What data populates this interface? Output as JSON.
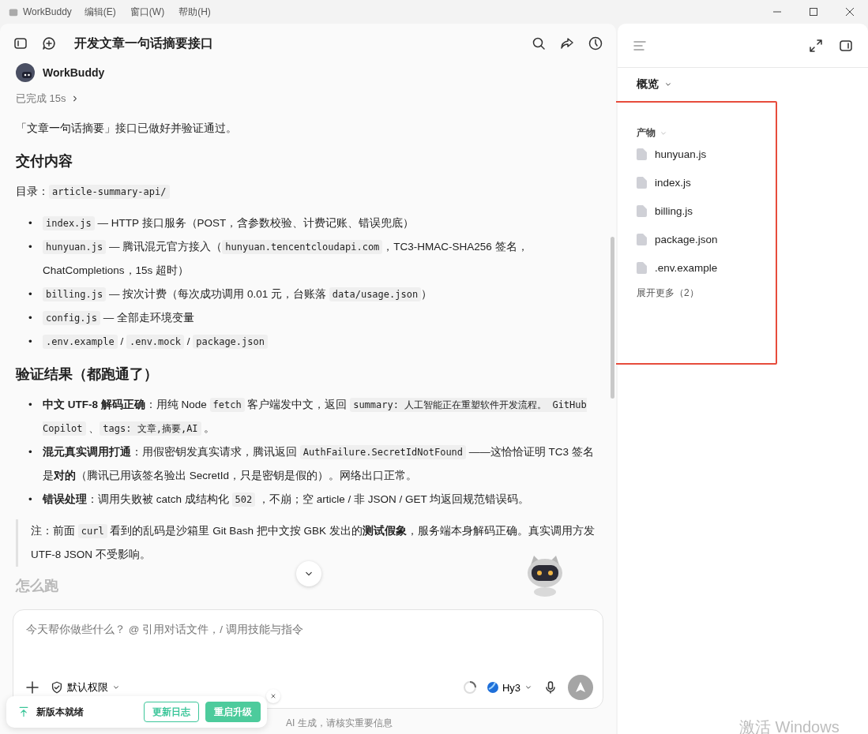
{
  "titlebar": {
    "app_name": "WorkBuddy",
    "menus": [
      "编辑(E)",
      "窗口(W)",
      "帮助(H)"
    ]
  },
  "chat": {
    "title": "开发文章一句话摘要接口",
    "sender": "WorkBuddy",
    "status": "已完成 15s",
    "blocks": [
      {
        "kind": "para",
        "segments": [
          {
            "kind": "text",
            "text": "「文章一句话摘要」接口已做好并验证通过。"
          }
        ]
      },
      {
        "kind": "heading",
        "text": "交付内容"
      },
      {
        "kind": "para",
        "segments": [
          {
            "kind": "text",
            "text": "目录："
          },
          {
            "kind": "code",
            "text": "article-summary-api/"
          }
        ]
      },
      {
        "kind": "list",
        "items": [
          {
            "marker": "•",
            "segments": [
              {
                "kind": "code",
                "text": "index.js"
              },
              {
                "kind": "text",
                "text": " — HTTP 接口服务（POST，含参数校验、计费记账、错误兜底）"
              }
            ]
          },
          {
            "marker": "•",
            "segments": [
              {
                "kind": "code",
                "text": "hunyuan.js"
              },
              {
                "kind": "text",
                "text": " — 腾讯混元官方接入（"
              },
              {
                "kind": "code",
                "text": "hunyuan.tencentcloudapi.com"
              },
              {
                "kind": "text",
                "text": "，TC3-HMAC-SHA256 签名，ChatCompletions，15s 超时）"
              }
            ]
          },
          {
            "marker": "•",
            "segments": [
              {
                "kind": "code",
                "text": "billing.js"
              },
              {
                "kind": "text",
                "text": " — 按次计费（每次成功调用 0.01 元，台账落 "
              },
              {
                "kind": "code",
                "text": "data/usage.json"
              },
              {
                "kind": "text",
                "text": "）"
              }
            ]
          },
          {
            "marker": "•",
            "segments": [
              {
                "kind": "code",
                "text": "config.js"
              },
              {
                "kind": "text",
                "text": " — 全部走环境变量"
              }
            ]
          },
          {
            "marker": "•",
            "segments": [
              {
                "kind": "code",
                "text": ".env.example"
              },
              {
                "kind": "text",
                "text": " / "
              },
              {
                "kind": "code",
                "text": ".env.mock"
              },
              {
                "kind": "text",
                "text": " / "
              },
              {
                "kind": "code",
                "text": "package.json"
              }
            ]
          }
        ]
      },
      {
        "kind": "heading",
        "text": "验证结果（都跑通了）"
      },
      {
        "kind": "list",
        "items": [
          {
            "marker": "•",
            "segments": [
              {
                "kind": "text",
                "text": "**中文 UTF-8 解码正确**：用纯 Node "
              },
              {
                "kind": "code",
                "text": "fetch"
              },
              {
                "kind": "text",
                "text": " 客户端发中文，返回 "
              },
              {
                "kind": "code",
                "text": "summary: 人工智能正在重塑软件开发流程。 GitHub Copilot"
              },
              {
                "kind": "text",
                "text": " 、"
              },
              {
                "kind": "code",
                "text": "tags: 文章,摘要,AI"
              },
              {
                "kind": "text",
                "text": " 。"
              }
            ]
          },
          {
            "marker": "•",
            "segments": [
              {
                "kind": "text",
                "text": "**混元真实调用打通**：用假密钥发真实请求，腾讯返回 "
              },
              {
                "kind": "code",
                "text": "AuthFailure.SecretIdNotFound"
              },
              {
                "kind": "text",
                "text": " ——这恰恰证明 TC3 签名是**对的**（腾讯已用该签名验出 SecretId，只是密钥是假的）。网络出口正常。"
              }
            ]
          },
          {
            "marker": "•",
            "segments": [
              {
                "kind": "text",
                "text": "**错误处理**：调用失败被 catch 成结构化 "
              },
              {
                "kind": "code",
                "text": "502"
              },
              {
                "kind": "text",
                "text": " ，不崩；空 article / 非 JSON / GET 均返回规范错误码。"
              }
            ]
          }
        ]
      },
      {
        "kind": "quote",
        "segments": [
          {
            "kind": "text",
            "text": "注：前面 "
          },
          {
            "kind": "code",
            "text": "curl"
          },
          {
            "kind": "text",
            "text": " 看到的乱码是沙箱里 Git Bash 把中文按 GBK 发出的**测试假象**，服务端本身解码正确。真实调用方发 UTF-8 JSON 不受影响。"
          }
        ]
      },
      {
        "kind": "faded_heading",
        "text": "怎么跑"
      }
    ]
  },
  "composer": {
    "placeholder": "今天帮你做些什么？ @ 引用对话文件，/ 调用技能与指令",
    "permission": "默认权限",
    "model": "Hy3"
  },
  "disclaimer": "AI 生成，请核实重要信息",
  "toast": {
    "message": "新版本就绪",
    "buttons": [
      {
        "label": "更新日志",
        "kind": "outline"
      },
      {
        "label": "重启升级",
        "kind": "filled"
      }
    ]
  },
  "panel": {
    "overview": "概览",
    "section": "产物",
    "files": [
      "hunyuan.js",
      "index.js",
      "billing.js",
      "package.json",
      ".env.example"
    ],
    "more": "展开更多（2）"
  },
  "os_overlay": "激活 Windows"
}
